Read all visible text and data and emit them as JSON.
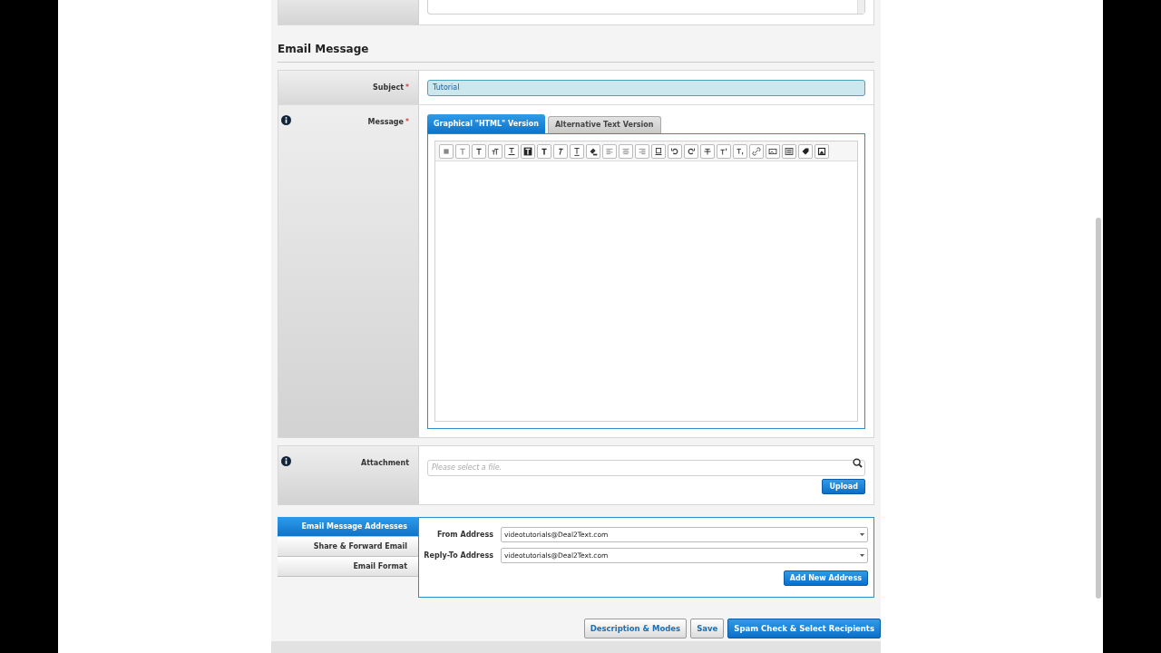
{
  "section_title": "Email Message",
  "required_mark": "*",
  "subject": {
    "label": "Subject",
    "required": true,
    "value": "Tutorial"
  },
  "message": {
    "label": "Message",
    "required": true,
    "info": true,
    "tabs": [
      {
        "label": "Graphical \"HTML\" Version",
        "selected": true
      },
      {
        "label": "Alternative Text Version",
        "selected": false
      }
    ]
  },
  "attachment": {
    "label": "Attachment",
    "info": true,
    "placeholder": "Please select a file.",
    "button": "Upload"
  },
  "address_tabs": [
    {
      "label": "Email Message Addresses",
      "selected": true
    },
    {
      "label": "Share & Forward Email",
      "selected": false
    },
    {
      "label": "Email Format",
      "selected": false
    }
  ],
  "address_fields": [
    {
      "label": "From Address",
      "value": "videotutorials@Deal2Text.com"
    },
    {
      "label": "Reply-To Address",
      "value": "videotutorials@Deal2Text.com"
    }
  ],
  "add_address_button": "Add New Address",
  "footer_buttons": [
    {
      "label": "Description & Modes",
      "kind": "secondary"
    },
    {
      "label": "Save",
      "kind": "secondary"
    },
    {
      "label": "Spam Check & Select Recipients",
      "kind": "primary"
    }
  ]
}
